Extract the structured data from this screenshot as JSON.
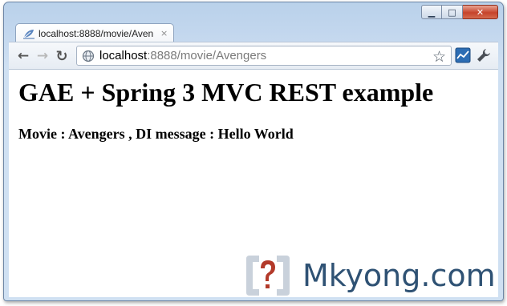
{
  "window": {
    "controls": {
      "minimize": "▁",
      "maximize": "□",
      "close": "✕"
    }
  },
  "tab": {
    "title": "localhost:8888/movie/Aven",
    "close_glyph": "×",
    "favicon": "spring-leaf-icon"
  },
  "toolbar": {
    "back_glyph": "←",
    "forward_glyph": "→",
    "reload_glyph": "↻",
    "url_host": "localhost",
    "url_path": ":8888/movie/Avengers",
    "star_glyph": "☆"
  },
  "page": {
    "heading": "GAE + Spring 3 MVC REST example",
    "message": "Movie : Avengers , DI message : Hello World"
  },
  "watermark": {
    "text": "Mkyong.com",
    "color": "#2f5274",
    "logo_color": "#b33a2a"
  }
}
